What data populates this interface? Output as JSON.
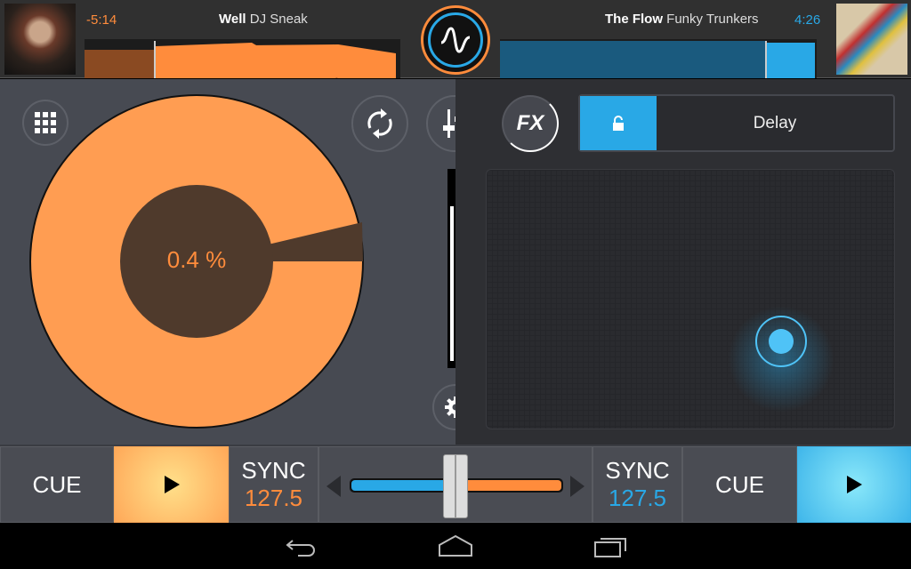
{
  "deck_a": {
    "time": "-5:14",
    "track": "Well",
    "artist": "DJ Sneak",
    "pitch": "0.4 %",
    "cue": "CUE",
    "sync": "SYNC",
    "bpm": "127.5",
    "color": "#ff8c3c",
    "progress": 0.22
  },
  "deck_b": {
    "time": "4:26",
    "track": "The Flow",
    "artist": "Funky Trunkers",
    "cue": "CUE",
    "sync": "SYNC",
    "bpm": "127.5",
    "color": "#29a8e6",
    "progress": 0.84
  },
  "fx": {
    "label": "FX",
    "effect": "Delay",
    "locked": false
  },
  "crossfader": {
    "position": 0.5
  },
  "nav": {
    "icons": [
      "back-icon",
      "home-icon",
      "recents-icon"
    ]
  }
}
